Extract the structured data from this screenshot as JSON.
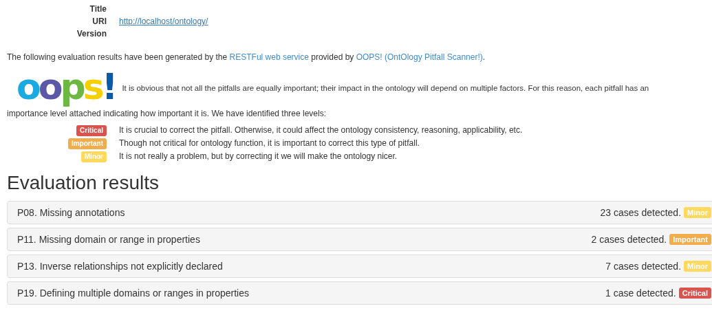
{
  "metadata": [
    {
      "label": "Title"
    },
    {
      "label": "URI",
      "value": "http://localhost/ontology/"
    },
    {
      "label": "Version"
    }
  ],
  "intro": {
    "before": "The following evaluation results have been generated by the ",
    "link1": "RESTFul web service",
    "middle": " provided by ",
    "link2": "OOPS! (OntOlogy Pitfall Scanner!)",
    "after": "."
  },
  "logo": "oops!",
  "importance_text": [
    "It is obvious that not all the pitfalls are equally important; their impact in the ontology will depend on multiple factors. For this reason, each pitfall has an",
    "importance level attached indicating how important it is. We have identified three levels:"
  ],
  "levels": [
    {
      "badge": "Critical",
      "color": "#d9534f",
      "description": "It is crucial to correct the pitfall. Otherwise, it could affect the ontology consistency, reasoning, applicability, etc."
    },
    {
      "badge": "Important",
      "color": "#f0ad4e",
      "description": "Though not critical for ontology function, it is important to correct this type of pitfall."
    },
    {
      "badge": "Minor",
      "color": "#ffd85e",
      "description": "It is not really a problem, but by correcting it we will make the ontology nicer."
    }
  ],
  "results_heading": "Evaluation results",
  "results": [
    {
      "title": "P08. Missing annotations",
      "cases": "23 cases detected.",
      "badge": "Minor",
      "color": "#ffd85e"
    },
    {
      "title": "P11. Missing domain or range in properties",
      "cases": "2 cases detected.",
      "badge": "Important",
      "color": "#f0ad4e"
    },
    {
      "title": "P13. Inverse relationships not explicitly declared",
      "cases": "7 cases detected.",
      "badge": "Minor",
      "color": "#ffd85e"
    },
    {
      "title": "P19. Defining multiple domains or ranges in properties",
      "cases": "1 case detected.",
      "badge": "Critical",
      "color": "#d9534f"
    }
  ]
}
